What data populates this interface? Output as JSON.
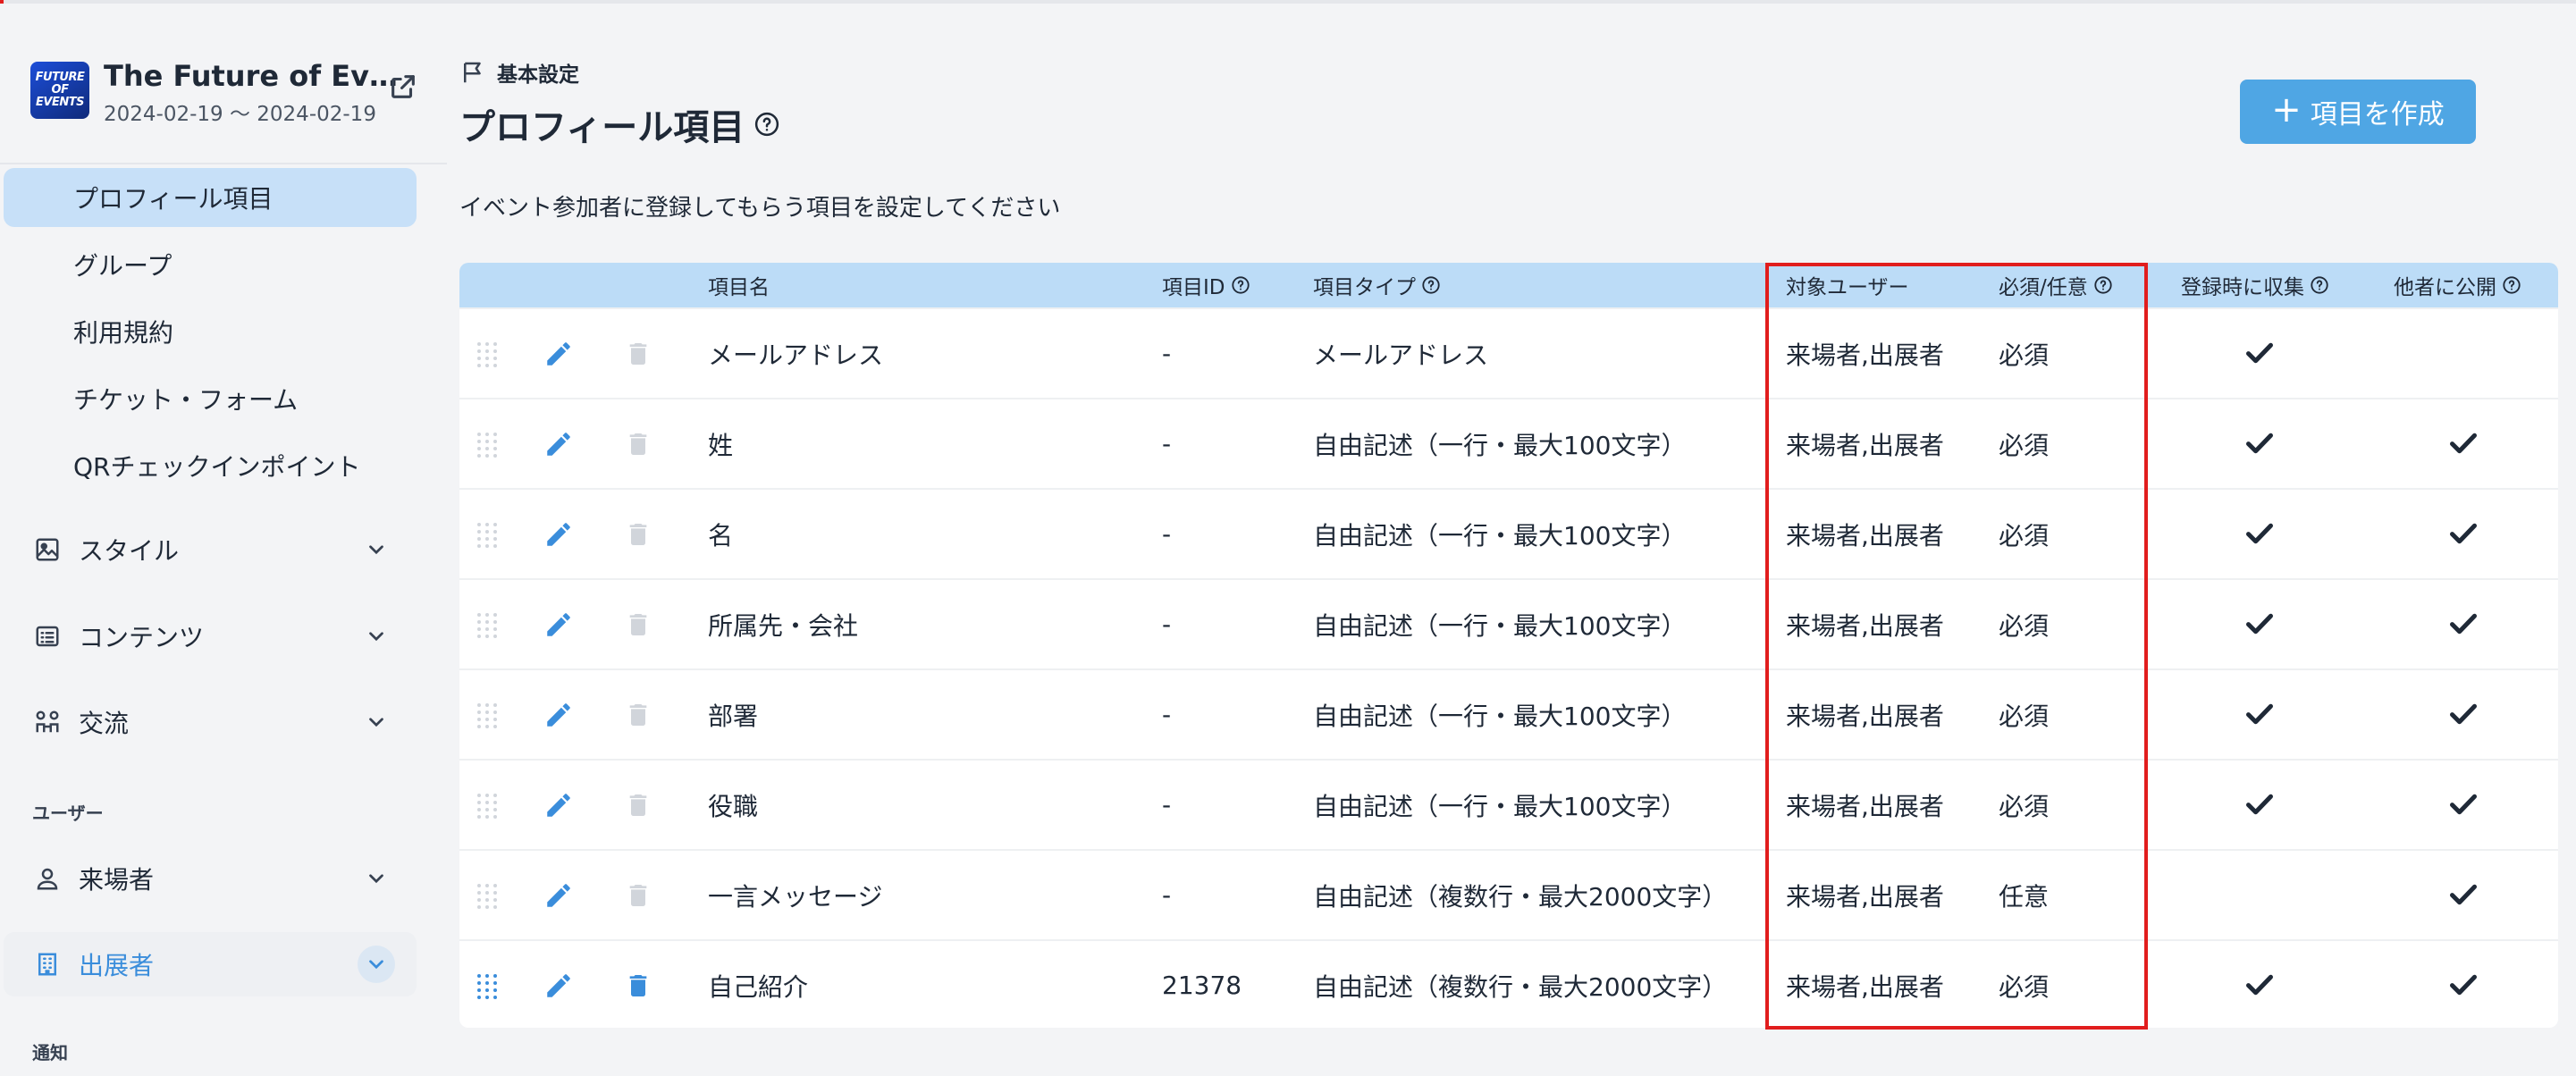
{
  "event": {
    "logo_lines": [
      "FUTURE",
      "OF",
      "EVENTS"
    ],
    "title": "The Future of Eve…",
    "date_range": "2024-02-19 〜 2024-02-19"
  },
  "sidebar": {
    "sub_items": [
      {
        "label": "プロフィール項目",
        "active": true
      },
      {
        "label": "グループ"
      },
      {
        "label": "利用規約"
      },
      {
        "label": "チケット・フォーム"
      },
      {
        "label": "QRチェックインポイント"
      }
    ],
    "nav_items": [
      {
        "label": "スタイル",
        "icon": "image-icon"
      },
      {
        "label": "コンテンツ",
        "icon": "list-icon"
      },
      {
        "label": "交流",
        "icon": "people-icon"
      }
    ],
    "section_user": "ユーザー",
    "user_items": [
      {
        "label": "来場者",
        "icon": "person-icon"
      },
      {
        "label": "出展者",
        "icon": "building-icon",
        "active": true
      }
    ],
    "section_notify": "通知"
  },
  "header": {
    "breadcrumb": "基本設定",
    "title": "プロフィール項目",
    "create_button": "項目を作成",
    "description": "イベント参加者に登録してもらう項目を設定してください"
  },
  "table": {
    "columns": {
      "name": "項目名",
      "id": "項目ID",
      "type": "項目タイプ",
      "target": "対象ユーザー",
      "required": "必須/任意",
      "collect": "登録時に収集",
      "public": "他者に公開"
    },
    "rows": [
      {
        "name": "メールアドレス",
        "id": "-",
        "type": "メールアドレス",
        "target": "来場者,出展者",
        "required": "必須",
        "collect": true,
        "public": false,
        "deletable": false
      },
      {
        "name": "姓",
        "id": "-",
        "type": "自由記述（一行・最大100文字）",
        "target": "来場者,出展者",
        "required": "必須",
        "collect": true,
        "public": true,
        "deletable": false
      },
      {
        "name": "名",
        "id": "-",
        "type": "自由記述（一行・最大100文字）",
        "target": "来場者,出展者",
        "required": "必須",
        "collect": true,
        "public": true,
        "deletable": false
      },
      {
        "name": "所属先・会社",
        "id": "-",
        "type": "自由記述（一行・最大100文字）",
        "target": "来場者,出展者",
        "required": "必須",
        "collect": true,
        "public": true,
        "deletable": false
      },
      {
        "name": "部署",
        "id": "-",
        "type": "自由記述（一行・最大100文字）",
        "target": "来場者,出展者",
        "required": "必須",
        "collect": true,
        "public": true,
        "deletable": false
      },
      {
        "name": "役職",
        "id": "-",
        "type": "自由記述（一行・最大100文字）",
        "target": "来場者,出展者",
        "required": "必須",
        "collect": true,
        "public": true,
        "deletable": false
      },
      {
        "name": "一言メッセージ",
        "id": "-",
        "type": "自由記述（複数行・最大2000文字）",
        "target": "来場者,出展者",
        "required": "任意",
        "collect": false,
        "public": true,
        "deletable": false
      },
      {
        "name": "自己紹介",
        "id": "21378",
        "type": "自由記述（複数行・最大2000文字）",
        "target": "来場者,出展者",
        "required": "必須",
        "collect": true,
        "public": true,
        "deletable": true
      }
    ]
  },
  "colors": {
    "accent": "#3a8ddb",
    "button": "#4fa6e4",
    "table_header": "#bcdcf7",
    "active_item": "#c7e0f8",
    "highlight": "#e11d1d",
    "disabled_icon": "#d1d5db"
  }
}
